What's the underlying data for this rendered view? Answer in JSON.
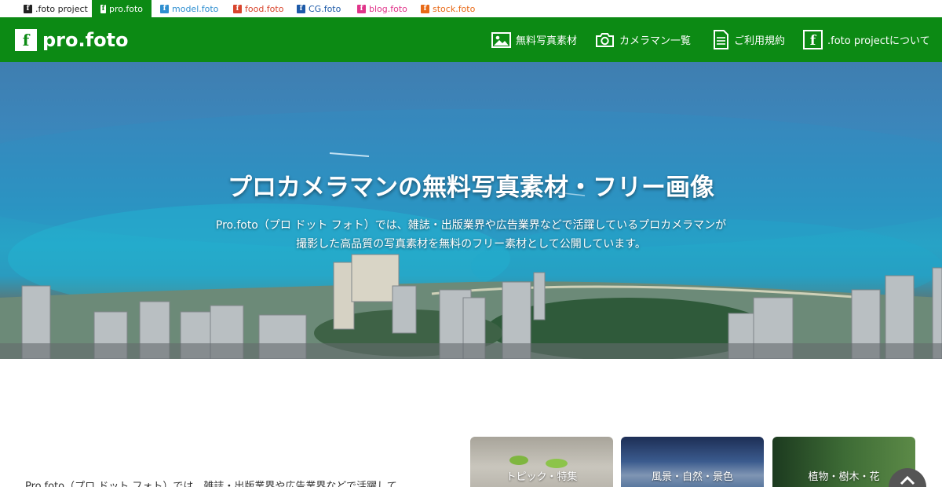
{
  "network_tabs": [
    {
      "label": ".foto project",
      "color": "#222222"
    },
    {
      "label": "pro.foto",
      "color": "#ffffff"
    },
    {
      "label": "model.foto",
      "color": "#2f8fd0"
    },
    {
      "label": "food.foto",
      "color": "#d8452d"
    },
    {
      "label": "CG.foto",
      "color": "#1d5aa8"
    },
    {
      "label": "blog.foto",
      "color": "#e0348a"
    },
    {
      "label": "stock.foto",
      "color": "#e86a17"
    }
  ],
  "header": {
    "logo_mark": "f",
    "logo_text": "pro.foto",
    "nav": [
      {
        "label": "無料写真素材",
        "icon": "image-icon"
      },
      {
        "label": "カメラマン一覧",
        "icon": "camera-icon"
      },
      {
        "label": "ご利用規約",
        "icon": "document-icon"
      },
      {
        "label": ".foto projectについて",
        "icon": "foto-logo-icon"
      }
    ]
  },
  "hero": {
    "title": "プロカメラマンの無料写真素材・フリー画像",
    "desc_line1": "Pro.foto（プロ ドット フォト）では、雑誌・出版業界や広告業界などで活躍しているプロカメラマンが",
    "desc_line2": "撮影した高品質の写真素材を無料のフリー素材として公開しています。"
  },
  "intro_text": "Pro.foto（プロ ドット フォト）では、雑誌・出版業界や広告業界などで活躍して",
  "categories": [
    {
      "label": "トピック・特集"
    },
    {
      "label": "風景・自然・景色"
    },
    {
      "label": "植物・樹木・花"
    }
  ],
  "colors": {
    "brand_green": "#0c8a14"
  }
}
